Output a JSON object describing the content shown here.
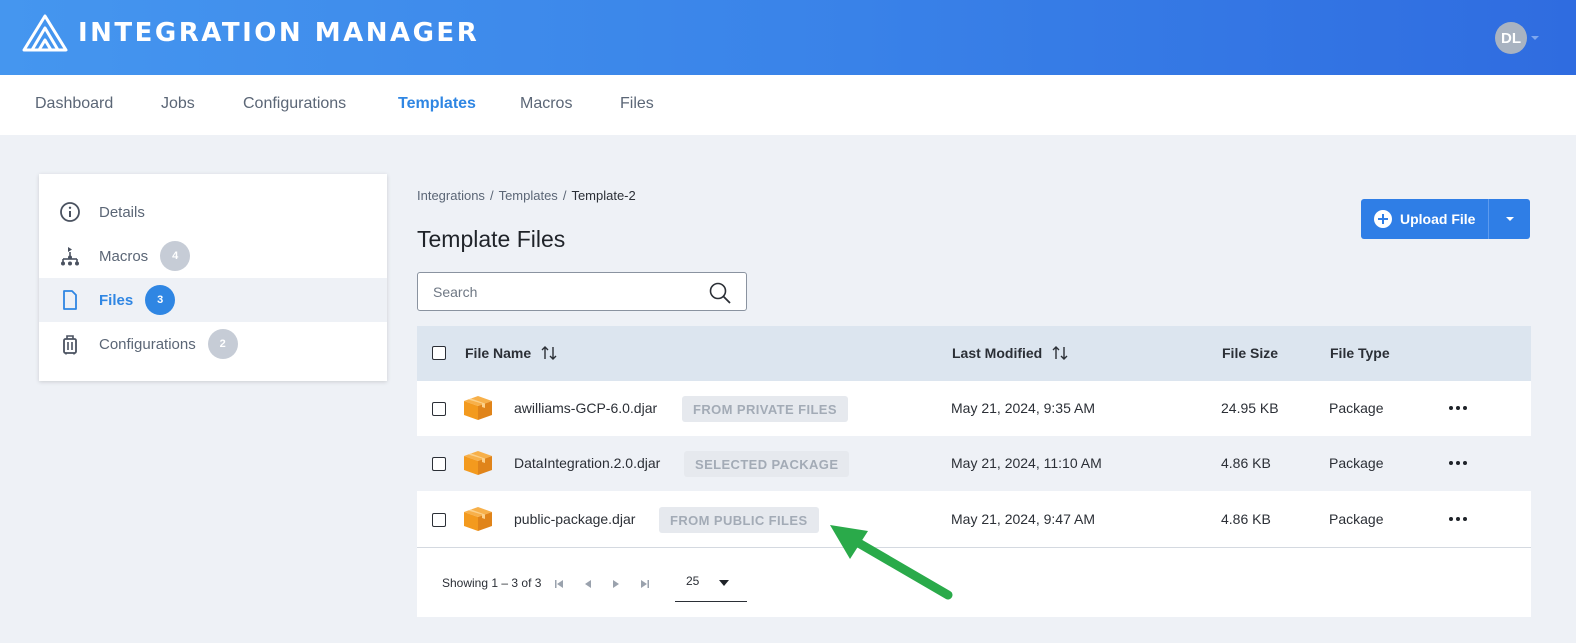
{
  "header": {
    "app_title": "INTEGRATION MANAGER",
    "logo_icon": "triangle-logo-icon",
    "user_initials": "DL"
  },
  "nav": {
    "items": [
      "Dashboard",
      "Jobs",
      "Configurations",
      "Templates",
      "Macros",
      "Files"
    ],
    "active": "Templates"
  },
  "sidebar": {
    "items": [
      {
        "label": "Details",
        "icon": "info-icon",
        "count": null
      },
      {
        "label": "Macros",
        "icon": "macro-tree-icon",
        "count": "4"
      },
      {
        "label": "Files",
        "icon": "file-icon",
        "count": "3",
        "active": true
      },
      {
        "label": "Configurations",
        "icon": "luggage-icon",
        "count": "2"
      }
    ]
  },
  "breadcrumb": {
    "items": [
      "Integrations",
      "Templates",
      "Template-2"
    ],
    "separator": "/"
  },
  "page_title": "Template Files",
  "upload": {
    "label": "Upload File"
  },
  "search": {
    "placeholder": "Search",
    "value": ""
  },
  "table": {
    "columns": {
      "file_name": "File Name",
      "last_modified": "Last Modified",
      "file_size": "File Size",
      "file_type": "File Type"
    },
    "rows": [
      {
        "name": "awilliams-GCP-6.0.djar",
        "tag": "FROM PRIVATE FILES",
        "modified": "May 21, 2024, 9:35 AM",
        "size": "24.95 KB",
        "type": "Package"
      },
      {
        "name": "DataIntegration.2.0.djar",
        "tag": "SELECTED PACKAGE",
        "modified": "May 21, 2024, 11:10 AM",
        "size": "4.86 KB",
        "type": "Package"
      },
      {
        "name": "public-package.djar",
        "tag": "FROM PUBLIC FILES",
        "modified": "May 21, 2024, 9:47 AM",
        "size": "4.86 KB",
        "type": "Package"
      }
    ]
  },
  "pagination": {
    "showing": "Showing 1 – 3 of 3",
    "per_page": "25"
  },
  "colors": {
    "header_gradient_start": "#4596ef",
    "header_gradient_end": "#2f6ce0",
    "accent": "#2f86e3",
    "package_icon": "#f39a1e",
    "annotation_arrow": "#2aaa4a"
  }
}
